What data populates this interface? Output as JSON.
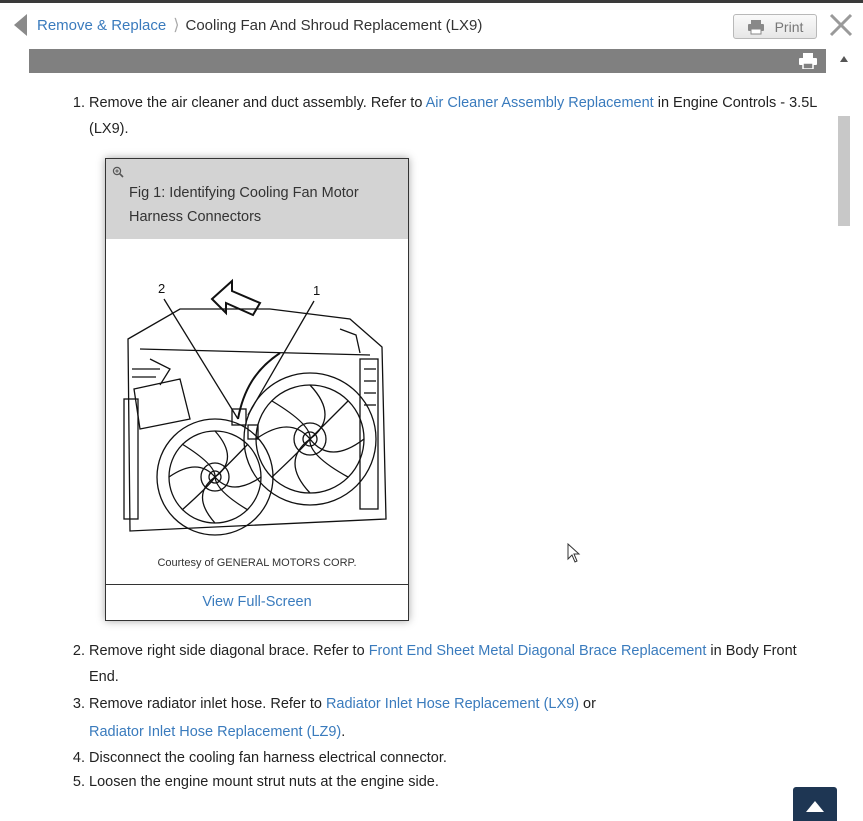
{
  "breadcrumb": {
    "parent": "Remove & Replace",
    "current": "Cooling Fan And Shroud Replacement (LX9)"
  },
  "toolbar": {
    "print_label": "Print"
  },
  "steps": {
    "s1": {
      "pre": "Remove the air cleaner and duct assembly. Refer to ",
      "link": "Air Cleaner Assembly Replacement",
      "post": " in Engine Controls - 3.5L (LX9)."
    },
    "s2": {
      "pre": "Remove right side diagonal brace. Refer to ",
      "link": "Front End Sheet Metal Diagonal Brace Replacement",
      "post": " in Body Front End."
    },
    "s3": {
      "pre": "Remove radiator inlet hose. Refer to ",
      "link1": "Radiator Inlet Hose Replacement (LX9)",
      "mid": " or ",
      "link2": "Radiator Inlet Hose Replacement (LZ9)",
      "post": "."
    },
    "s4": "Disconnect the cooling fan harness electrical connector.",
    "s5": "Loosen the engine mount strut nuts at the engine side."
  },
  "figure": {
    "caption": "Fig 1: Identifying Cooling Fan Motor Harness Connectors",
    "callout_1": "1",
    "callout_2": "2",
    "courtesy": "Courtesy of GENERAL MOTORS CORP.",
    "fullscreen_label": "View Full-Screen"
  },
  "icons": [
    "back-arrow-icon",
    "print-icon",
    "close-icon",
    "zoom-in-icon",
    "scroll-top-icon",
    "mouse-cursor-icon"
  ],
  "colors": {
    "link": "#3a7bbd",
    "bar": "#808080",
    "to_top": "#1e3653"
  }
}
